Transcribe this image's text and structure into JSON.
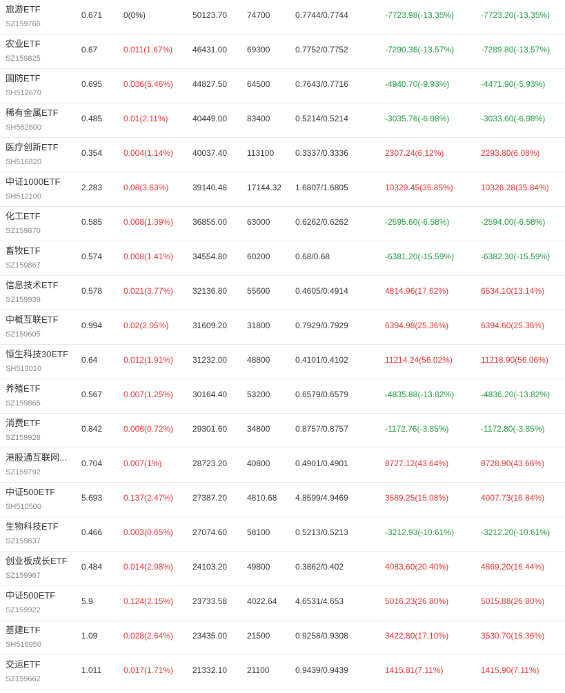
{
  "colors": {
    "up": "#e93030",
    "down": "#1f9a3f",
    "flat": "#333333"
  },
  "rows": [
    {
      "name": "旅游ETF",
      "code": "SZ159766",
      "price": "0.671",
      "change": "0(0%)",
      "change_dir": "flat",
      "scale": "50123.70",
      "volume": "74700",
      "nav": "0.7744/0.7744",
      "v1": "-7723.98(-13.35%)",
      "v1_dir": "down",
      "v2": "-7723.20(-13.35%)",
      "v2_dir": "down"
    },
    {
      "name": "农业ETF",
      "code": "SZ159825",
      "price": "0.67",
      "change": "0.011(1.67%)",
      "change_dir": "up",
      "scale": "46431.00",
      "volume": "69300",
      "nav": "0.7752/0.7752",
      "v1": "-7290.36(-13.57%)",
      "v1_dir": "down",
      "v2": "-7289.80(-13.57%)",
      "v2_dir": "down"
    },
    {
      "name": "国防ETF",
      "code": "SH512670",
      "price": "0.695",
      "change": "0.036(5.46%)",
      "change_dir": "up",
      "scale": "44827.50",
      "volume": "64500",
      "nav": "0.7643/0.7716",
      "v1": "-4940.70(-9.93%)",
      "v1_dir": "down",
      "v2": "-4471.90(-5.93%)",
      "v2_dir": "down"
    },
    {
      "name": "稀有金属ETF",
      "code": "SH562800",
      "price": "0.485",
      "change": "0.01(2.11%)",
      "change_dir": "up",
      "scale": "40449.00",
      "volume": "83400",
      "nav": "0.5214/0.5214",
      "v1": "-3035.76(-6.98%)",
      "v1_dir": "down",
      "v2": "-3033.60(-6.98%)",
      "v2_dir": "down"
    },
    {
      "name": "医疗创新ETF",
      "code": "SH516820",
      "price": "0.354",
      "change": "0.004(1.14%)",
      "change_dir": "up",
      "scale": "40037.40",
      "volume": "113100",
      "nav": "0.3337/0.3336",
      "v1": "2307.24(6.12%)",
      "v1_dir": "up",
      "v2": "2293.80(6.08%)",
      "v2_dir": "up"
    },
    {
      "name": "中证1000ETF",
      "code": "SH512100",
      "price": "2.283",
      "change": "0.08(3.63%)",
      "change_dir": "up",
      "scale": "39140.48",
      "volume": "17144.32",
      "nav": "1.6807/1.6805",
      "v1": "10329.45(35.85%)",
      "v1_dir": "up",
      "v2": "10326.28(35.84%)",
      "v2_dir": "up"
    },
    {
      "name": "化工ETF",
      "code": "SZ159870",
      "price": "0.585",
      "change": "0.008(1.39%)",
      "change_dir": "up",
      "scale": "36855.00",
      "volume": "63000",
      "nav": "0.6262/0.6262",
      "v1": "-2595.60(-6.58%)",
      "v1_dir": "down",
      "v2": "-2594.00(-6.58%)",
      "v2_dir": "down"
    },
    {
      "name": "畜牧ETF",
      "code": "SZ159867",
      "price": "0.574",
      "change": "0.008(1.41%)",
      "change_dir": "up",
      "scale": "34554.80",
      "volume": "60200",
      "nav": "0.68/0.68",
      "v1": "-6381.20(-15.59%)",
      "v1_dir": "down",
      "v2": "-6382.30(-15.59%)",
      "v2_dir": "down"
    },
    {
      "name": "信息技术ETF",
      "code": "SZ159939",
      "price": "0.578",
      "change": "0.021(3.77%)",
      "change_dir": "up",
      "scale": "32136.80",
      "volume": "55600",
      "nav": "0.4605/0.4914",
      "v1": "4814.96(17.62%)",
      "v1_dir": "up",
      "v2": "6534.10(13.14%)",
      "v2_dir": "up"
    },
    {
      "name": "中概互联ETF",
      "code": "SZ159605",
      "price": "0.994",
      "change": "0.02(2.05%)",
      "change_dir": "up",
      "scale": "31609.20",
      "volume": "31800",
      "nav": "0.7929/0.7929",
      "v1": "6394.98(25.36%)",
      "v1_dir": "up",
      "v2": "6394.60(25.36%)",
      "v2_dir": "up"
    },
    {
      "name": "恒生科技30ETF",
      "code": "SH513010",
      "price": "0.64",
      "change": "0.012(1.91%)",
      "change_dir": "up",
      "scale": "31232.00",
      "volume": "48800",
      "nav": "0.4101/0.4102",
      "v1": "11214.24(56.02%)",
      "v1_dir": "up",
      "v2": "11218.90(56.06%)",
      "v2_dir": "up"
    },
    {
      "name": "养殖ETF",
      "code": "SZ159865",
      "price": "0.567",
      "change": "0.007(1.25%)",
      "change_dir": "up",
      "scale": "30164.40",
      "volume": "53200",
      "nav": "0.6579/0.6579",
      "v1": "-4835.88(-13.82%)",
      "v1_dir": "down",
      "v2": "-4836.20(-13.82%)",
      "v2_dir": "down"
    },
    {
      "name": "消费ETF",
      "code": "SZ159928",
      "price": "0.842",
      "change": "0.006(0.72%)",
      "change_dir": "up",
      "scale": "29301.60",
      "volume": "34800",
      "nav": "0.8757/0.8757",
      "v1": "-1172.76(-3.85%)",
      "v1_dir": "down",
      "v2": "-1172.80(-3.85%)",
      "v2_dir": "down"
    },
    {
      "name": "港股通互联网...",
      "code": "SZ159792",
      "price": "0.704",
      "change": "0.007(1%)",
      "change_dir": "up",
      "scale": "28723.20",
      "volume": "40800",
      "nav": "0.4901/0.4901",
      "v1": "8727.12(43.64%)",
      "v1_dir": "up",
      "v2": "8728.90(43.66%)",
      "v2_dir": "up"
    },
    {
      "name": "中证500ETF",
      "code": "SH510500",
      "price": "5.693",
      "change": "0.137(2.47%)",
      "change_dir": "up",
      "scale": "27387.20",
      "volume": "4810.68",
      "nav": "4.8599/4.9469",
      "v1": "3589.25(15.08%)",
      "v1_dir": "up",
      "v2": "4007.73(16.84%)",
      "v2_dir": "up"
    },
    {
      "name": "生物科技ETF",
      "code": "SZ159837",
      "price": "0.466",
      "change": "0.003(0.65%)",
      "change_dir": "up",
      "scale": "27074.60",
      "volume": "58100",
      "nav": "0.5213/0.5213",
      "v1": "-3212.93(-10.61%)",
      "v1_dir": "down",
      "v2": "-3212.20(-10.61%)",
      "v2_dir": "down"
    },
    {
      "name": "创业板成长ETF",
      "code": "SZ159967",
      "price": "0.484",
      "change": "0.014(2.98%)",
      "change_dir": "up",
      "scale": "24103.20",
      "volume": "49800",
      "nav": "0.3862/0.402",
      "v1": "4083.60(20.40%)",
      "v1_dir": "up",
      "v2": "4869.20(16.44%)",
      "v2_dir": "up"
    },
    {
      "name": "中证500ETF",
      "code": "SZ159922",
      "price": "5.9",
      "change": "0.124(2.15%)",
      "change_dir": "up",
      "scale": "23733.58",
      "volume": "4022.64",
      "nav": "4.6531/4.653",
      "v1": "5016.23(26.80%)",
      "v1_dir": "up",
      "v2": "5015.88(26.80%)",
      "v2_dir": "up"
    },
    {
      "name": "基建ETF",
      "code": "SH516950",
      "price": "1.09",
      "change": "0.028(2.64%)",
      "change_dir": "up",
      "scale": "23435.00",
      "volume": "21500",
      "nav": "0.9258/0.9308",
      "v1": "3422.80(17.10%)",
      "v1_dir": "up",
      "v2": "3530.70(15.36%)",
      "v2_dir": "up"
    },
    {
      "name": "交运ETF",
      "code": "SZ159662",
      "price": "1.011",
      "change": "0.017(1.71%)",
      "change_dir": "up",
      "scale": "21332.10",
      "volume": "21100",
      "nav": "0.9439/0.9439",
      "v1": "1415.81(7.11%)",
      "v1_dir": "up",
      "v2": "1415.90(7.11%)",
      "v2_dir": "up"
    }
  ]
}
